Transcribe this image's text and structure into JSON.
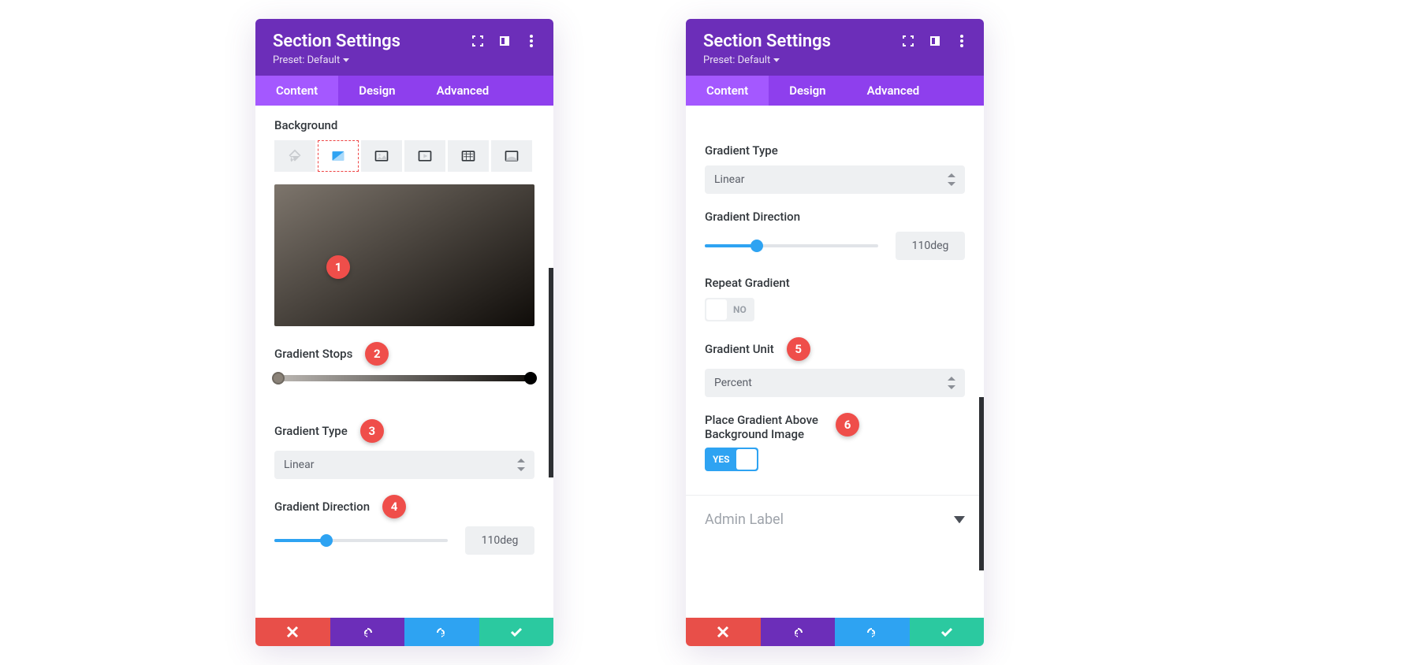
{
  "header": {
    "title": "Section Settings",
    "preset": "Preset: Default"
  },
  "tabs": {
    "content": "Content",
    "design": "Design",
    "advanced": "Advanced"
  },
  "left": {
    "background_label": "Background",
    "gradient_stops_label": "Gradient Stops",
    "gradient_type_label": "Gradient Type",
    "gradient_type_value": "Linear",
    "gradient_direction_label": "Gradient Direction",
    "gradient_direction_value": "110deg"
  },
  "right": {
    "gradient_type_label": "Gradient Type",
    "gradient_type_value": "Linear",
    "gradient_direction_label": "Gradient Direction",
    "gradient_direction_value": "110deg",
    "repeat_gradient_label": "Repeat Gradient",
    "repeat_gradient_value": "NO",
    "gradient_unit_label": "Gradient Unit",
    "gradient_unit_value": "Percent",
    "place_above_label": "Place Gradient Above Background Image",
    "place_above_value": "YES",
    "admin_label": "Admin Label"
  },
  "callouts": {
    "c1": "1",
    "c2": "2",
    "c3": "3",
    "c4": "4",
    "c5": "5",
    "c6": "6"
  }
}
